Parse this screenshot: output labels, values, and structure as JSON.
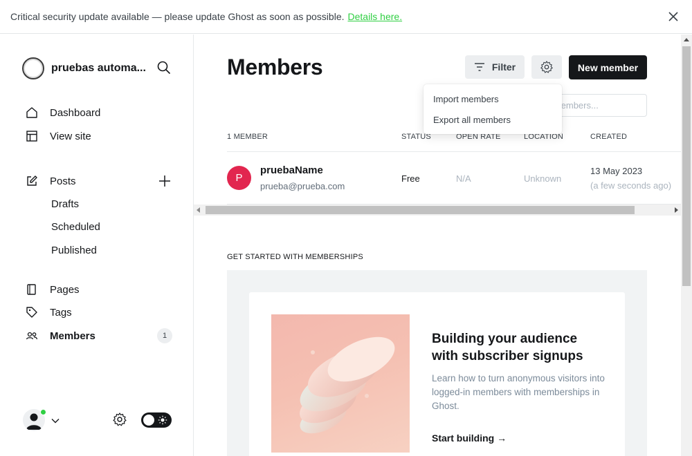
{
  "banner": {
    "text": "Critical security update available — please update Ghost as soon as possible.",
    "link": "Details here."
  },
  "sidebar": {
    "site_name": "pruebas automa...",
    "items": [
      {
        "label": "Dashboard",
        "icon": "home-icon"
      },
      {
        "label": "View site",
        "icon": "window-icon"
      },
      {
        "label": "Posts",
        "icon": "edit-icon"
      },
      {
        "label": "Drafts"
      },
      {
        "label": "Scheduled"
      },
      {
        "label": "Published"
      },
      {
        "label": "Pages",
        "icon": "page-icon"
      },
      {
        "label": "Tags",
        "icon": "tag-icon"
      },
      {
        "label": "Members",
        "icon": "members-icon",
        "count": "1"
      }
    ]
  },
  "header": {
    "title": "Members",
    "filter_label": "Filter",
    "new_member_label": "New member",
    "search_placeholder": "Search members..."
  },
  "actions_menu": {
    "items": [
      "Import members",
      "Export all members"
    ]
  },
  "table": {
    "columns": [
      "1 MEMBER",
      "STATUS",
      "OPEN RATE",
      "LOCATION",
      "CREATED"
    ],
    "rows": [
      {
        "initial": "P",
        "name": "pruebaName",
        "email": "prueba@prueba.com",
        "status": "Free",
        "open_rate": "N/A",
        "location": "Unknown",
        "created": "13 May 2023",
        "created_relative": "(a few seconds ago)"
      }
    ]
  },
  "promo": {
    "section_label": "GET STARTED WITH MEMBERSHIPS",
    "title": "Building your audience with subscriber signups",
    "description": "Learn how to turn anonymous visitors into logged-in members with memberships in Ghost.",
    "link": "Start building →"
  },
  "colors": {
    "accent_green": "#30cf43",
    "avatar_red": "#e2264f",
    "primary_dark": "#15171a"
  }
}
